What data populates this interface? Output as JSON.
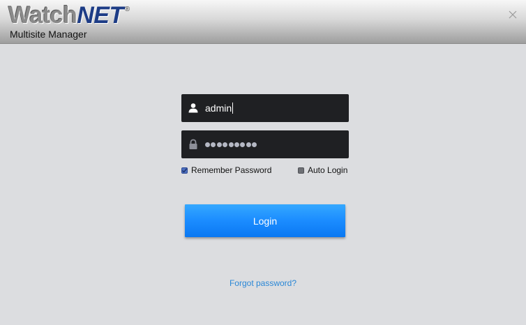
{
  "header": {
    "logo_text_watch": "Watch",
    "logo_text_net": "NET",
    "logo_registered": "®",
    "subtitle": "Multisite Manager",
    "close_icon": "close-icon"
  },
  "login_form": {
    "username": {
      "icon": "user-icon",
      "value": "admin"
    },
    "password": {
      "icon": "lock-icon",
      "masked_length": 9
    },
    "remember_password": {
      "label": "Remember Password",
      "checked": true
    },
    "auto_login": {
      "label": "Auto Login",
      "checked": false
    },
    "login_button_label": "Login",
    "forgot_password_label": "Forgot password?"
  },
  "colors": {
    "titlebar_top": "#f7f7f7",
    "titlebar_bottom": "#9e9e9e",
    "body_background": "#dcdde0",
    "field_background": "#1f2023",
    "login_button": "#1b8cff",
    "link": "#2a87d6",
    "logo_net": "#1d3c86"
  }
}
